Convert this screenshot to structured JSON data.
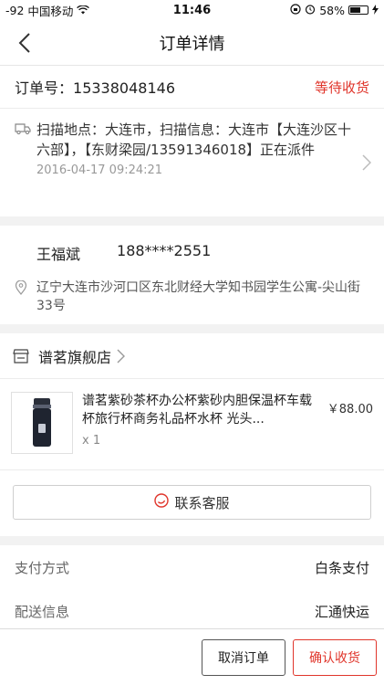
{
  "status_bar": {
    "signal": "-92",
    "carrier": "中国移动",
    "time": "11:46",
    "battery": "58%",
    "battery_level": 0.58
  },
  "nav": {
    "title": "订单详情",
    "back_icon": "chevron-left-icon"
  },
  "order": {
    "number_label": "订单号：",
    "number": "15338048146",
    "status": "等待收货"
  },
  "logistics": {
    "info": "扫描地点：大连市，扫描信息：大连市【大连沙区十六部】，【东财梁园/13591346018】正在派件",
    "time": "2016-04-17 09:24:21"
  },
  "address": {
    "name": "王福斌",
    "phone": "188****2551",
    "detail": "辽宁大连市沙河口区东北财经大学知书园学生公寓-尖山街33号"
  },
  "shop": {
    "name": "谱茗旗舰店"
  },
  "product": {
    "title": "谱茗紫砂茶杯办公杯紫砂内胆保温杯车载杯旅行杯商务礼品杯水杯 光头...",
    "price": "￥88.00",
    "qty": "x 1"
  },
  "contact": {
    "label": "联系客服"
  },
  "details": [
    {
      "key": "支付方式",
      "value": "白条支付"
    },
    {
      "key": "配送信息",
      "value": "汇通快运"
    }
  ],
  "actions": {
    "cancel": "取消订单",
    "confirm": "确认收货"
  },
  "colors": {
    "accent": "#e0352b",
    "background": "#f2f2f2"
  }
}
